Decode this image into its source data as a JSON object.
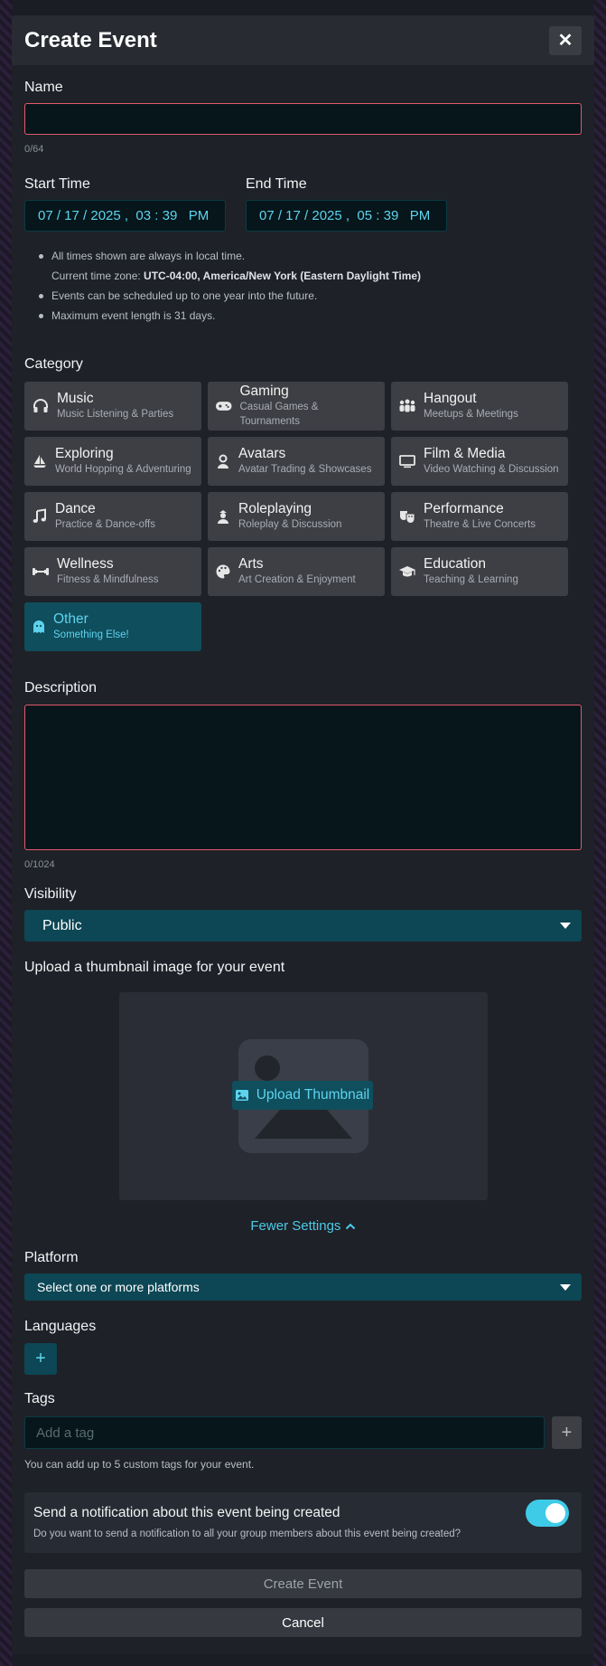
{
  "dialog": {
    "title": "Create Event",
    "close_label": "✕"
  },
  "name": {
    "label": "Name",
    "value": "",
    "counter": "0/64"
  },
  "start_time": {
    "label": "Start Time",
    "value": "07 / 17 / 2025 ,  03 : 39   PM"
  },
  "end_time": {
    "label": "End Time",
    "value": "07 / 17 / 2025 ,  05 : 39   PM"
  },
  "notes": {
    "line1": "All times shown are always in local time.",
    "tz_prefix": "Current time zone: ",
    "tz_value": "UTC-04:00, America/New York (Eastern Daylight Time)",
    "line2": "Events can be scheduled up to one year into the future.",
    "line3": "Maximum event length is 31 days."
  },
  "category": {
    "label": "Category",
    "items": [
      {
        "name": "Music",
        "sub": "Music Listening & Parties",
        "icon": "headphones-icon"
      },
      {
        "name": "Gaming",
        "sub": "Casual Games & Tournaments",
        "icon": "gamepad-icon"
      },
      {
        "name": "Hangout",
        "sub": "Meetups & Meetings",
        "icon": "people-icon"
      },
      {
        "name": "Exploring",
        "sub": "World Hopping & Adventuring",
        "icon": "sailboat-icon"
      },
      {
        "name": "Avatars",
        "sub": "Avatar Trading & Showcases",
        "icon": "user-icon"
      },
      {
        "name": "Film & Media",
        "sub": "Video Watching & Discussion",
        "icon": "monitor-icon"
      },
      {
        "name": "Dance",
        "sub": "Practice & Dance-offs",
        "icon": "music-note-icon"
      },
      {
        "name": "Roleplaying",
        "sub": "Roleplay & Discussion",
        "icon": "character-icon"
      },
      {
        "name": "Performance",
        "sub": "Theatre & Live Concerts",
        "icon": "masks-icon"
      },
      {
        "name": "Wellness",
        "sub": "Fitness & Mindfulness",
        "icon": "dumbbell-icon"
      },
      {
        "name": "Arts",
        "sub": "Art Creation & Enjoyment",
        "icon": "palette-icon"
      },
      {
        "name": "Education",
        "sub": "Teaching & Learning",
        "icon": "graduation-cap-icon"
      },
      {
        "name": "Other",
        "sub": "Something Else!",
        "icon": "ghost-icon"
      }
    ],
    "selected": "Other"
  },
  "description": {
    "label": "Description",
    "value": "",
    "counter": "0/1024"
  },
  "visibility": {
    "label": "Visibility",
    "value": "Public"
  },
  "thumbnail": {
    "label": "Upload a thumbnail image for your event",
    "button": "Upload Thumbnail"
  },
  "fewer_settings": "Fewer Settings",
  "platform": {
    "label": "Platform",
    "placeholder": "Select one or more platforms"
  },
  "languages": {
    "label": "Languages",
    "add": "+"
  },
  "tags": {
    "label": "Tags",
    "placeholder": "Add a tag",
    "add": "+",
    "help": "You can add up to 5 custom tags for your event."
  },
  "notification": {
    "title": "Send a notification about this event being created",
    "desc": "Do you want to send a notification to all your group members about this event being created?",
    "enabled": true
  },
  "buttons": {
    "create": "Create Event",
    "cancel": "Cancel"
  },
  "colors": {
    "accent": "#3ecbe8",
    "selected_bg": "#0f4e5c",
    "error_border": "#e05a6d"
  }
}
